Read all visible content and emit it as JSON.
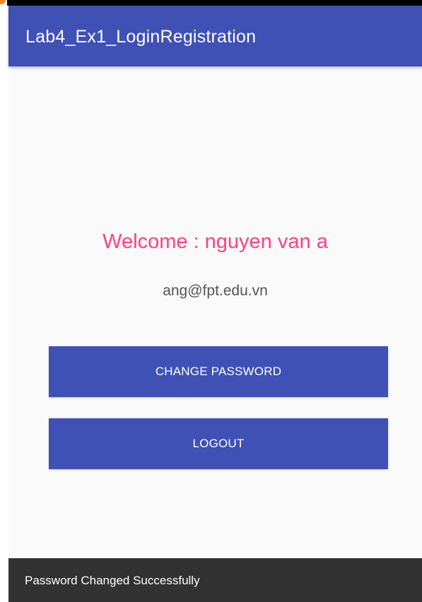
{
  "app_bar": {
    "title": "Lab4_Ex1_LoginRegistration",
    "color": "#3f51b5"
  },
  "main": {
    "welcome_text": "Welcome : nguyen van a",
    "welcome_color": "#ff4081",
    "email": "ang@fpt.edu.vn",
    "change_password_label": "CHANGE PASSWORD",
    "logout_label": "LOGOUT"
  },
  "snackbar": {
    "message": "Password Changed Successfully"
  }
}
